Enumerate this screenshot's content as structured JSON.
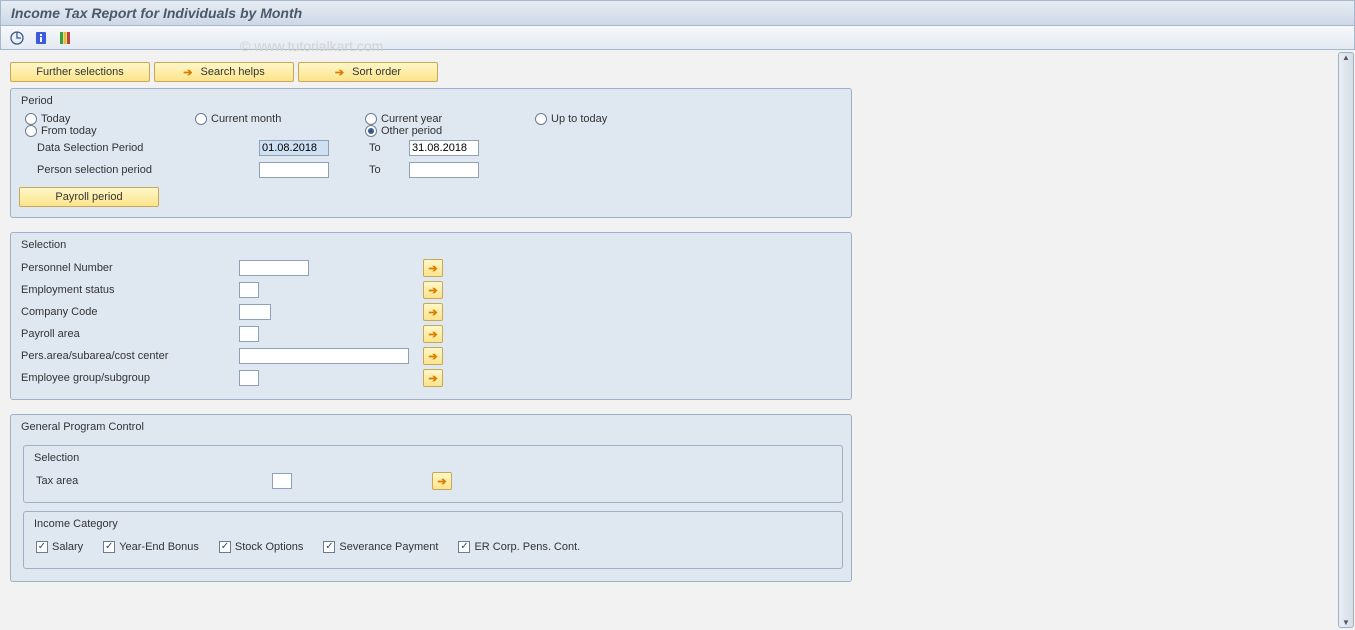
{
  "title": "Income Tax Report for Individuals by Month",
  "watermark": "© www.tutorialkart.com",
  "topButtons": {
    "further": "Further selections",
    "search": "Search helps",
    "sort": "Sort order"
  },
  "period": {
    "legend": "Period",
    "radios": {
      "today": "Today",
      "currentMonth": "Current month",
      "currentYear": "Current year",
      "upToToday": "Up to today",
      "fromToday": "From today",
      "other": "Other period"
    },
    "dataSelLabel": "Data Selection Period",
    "personSelLabel": "Person selection period",
    "toLabel": "To",
    "dataFrom": "01.08.2018",
    "dataTo": "31.08.2018",
    "personFrom": "",
    "personTo": "",
    "payrollBtn": "Payroll period"
  },
  "selection": {
    "legend": "Selection",
    "pernr": "Personnel Number",
    "empstatus": "Employment status",
    "companyCode": "Company Code",
    "payrollArea": "Payroll area",
    "paSubCost": "Pers.area/subarea/cost center",
    "eeGroup": "Employee group/subgroup"
  },
  "gpc": {
    "legend": "General Program Control",
    "selLegend": "Selection",
    "taxArea": "Tax area",
    "incCatLegend": "Income Category",
    "checks": {
      "salary": "Salary",
      "bonus": "Year-End Bonus",
      "stock": "Stock Options",
      "sever": "Severance Payment",
      "pens": "ER Corp. Pens. Cont."
    }
  }
}
